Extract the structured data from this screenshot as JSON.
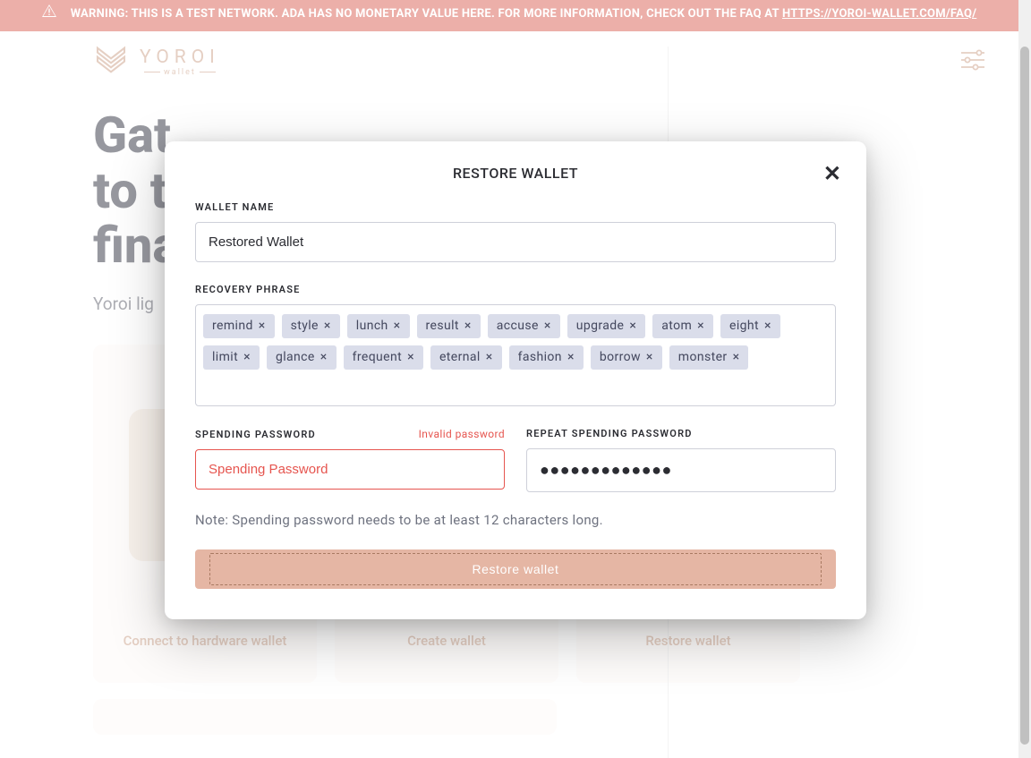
{
  "banner": {
    "text_prefix": "WARNING: THIS IS A TEST NETWORK. ADA HAS NO MONETARY VALUE HERE. FOR MORE INFORMATION, CHECK OUT THE FAQ AT ",
    "link_text": "HTTPS://YOROI-WALLET.COM/FAQ/"
  },
  "brand": {
    "name": "YOROI",
    "sub": "wallet"
  },
  "background": {
    "heading_l1": "Gat",
    "heading_l2": "to t",
    "heading_l3": "fina",
    "sub_line": "Yoroi lig",
    "cards": [
      {
        "label": "Connect to hardware wallet"
      },
      {
        "label": "Create wallet"
      },
      {
        "label": "Restore wallet"
      }
    ]
  },
  "modal": {
    "title": "RESTORE WALLET",
    "wallet_name_label": "WALLET NAME",
    "wallet_name_value": "Restored Wallet",
    "recovery_label": "RECOVERY PHRASE",
    "words": [
      "remind",
      "style",
      "lunch",
      "result",
      "accuse",
      "upgrade",
      "atom",
      "eight",
      "limit",
      "glance",
      "frequent",
      "eternal",
      "fashion",
      "borrow",
      "monster"
    ],
    "spending_label": "SPENDING PASSWORD",
    "spending_error": "Invalid password",
    "spending_placeholder": "Spending Password",
    "repeat_label": "REPEAT SPENDING PASSWORD",
    "repeat_value": "●●●●●●●●●●●●●",
    "note": "Note: Spending password needs to be at least 12 characters long.",
    "submit": "Restore wallet"
  }
}
